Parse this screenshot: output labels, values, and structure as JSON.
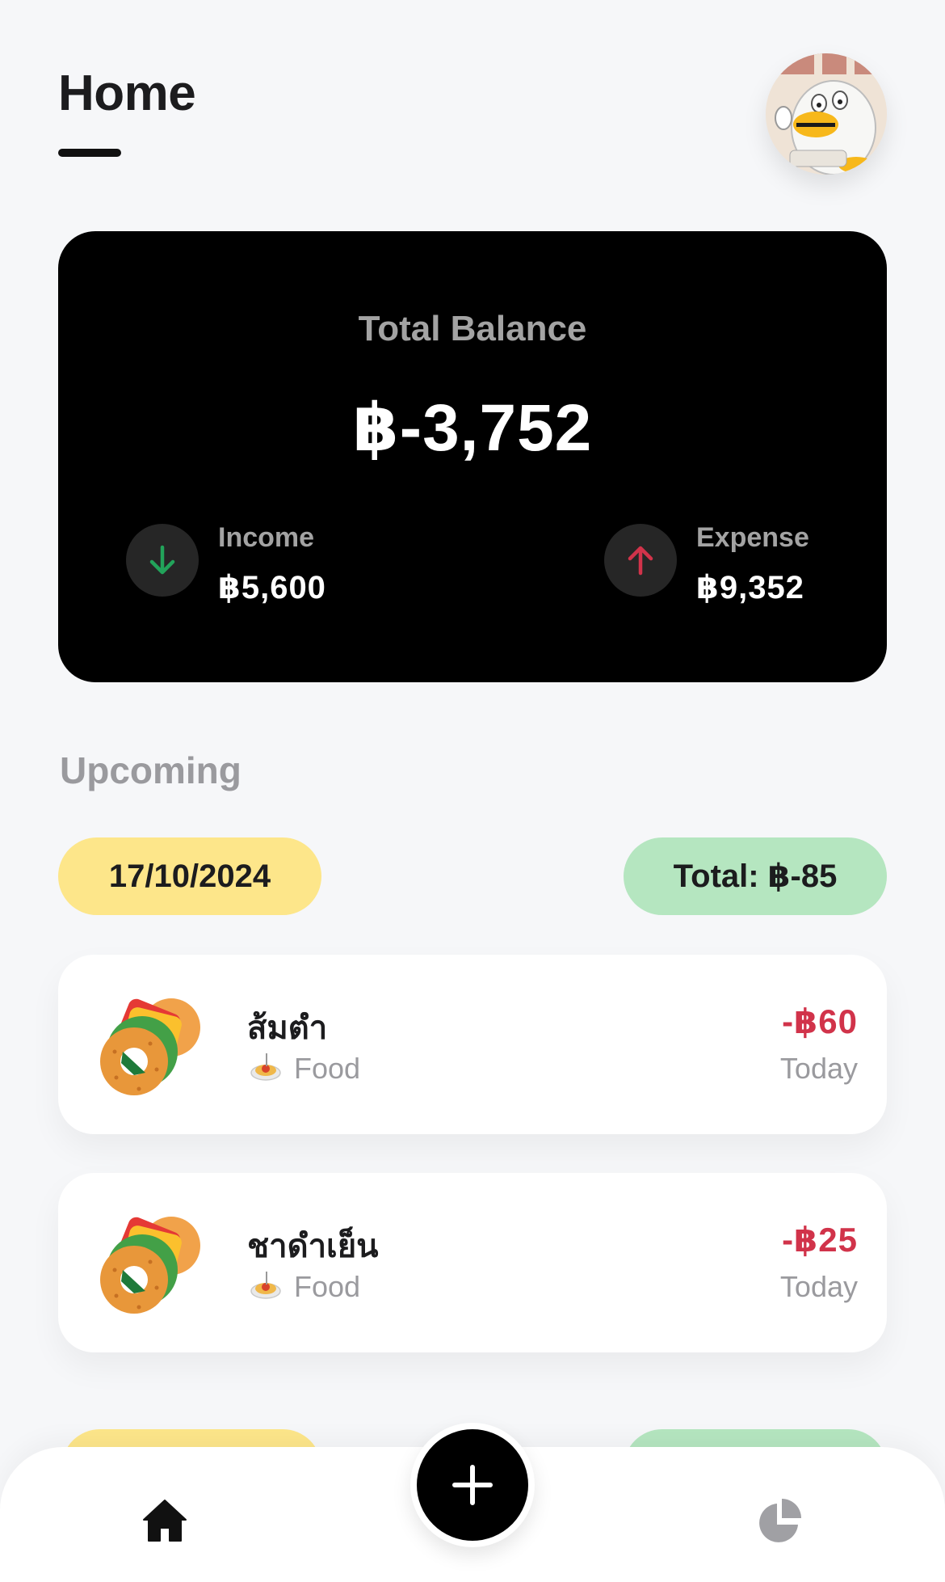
{
  "header": {
    "title": "Home"
  },
  "balance": {
    "label": "Total Balance",
    "value": "฿-3,752",
    "income": {
      "label": "Income",
      "value": "฿5,600",
      "icon": "arrow-down-icon",
      "color": "#22a35a"
    },
    "expense": {
      "label": "Expense",
      "value": "฿9,352",
      "icon": "arrow-up-icon",
      "color": "#d1334a"
    }
  },
  "upcoming": {
    "title": "Upcoming",
    "groups": [
      {
        "date": "17/10/2024",
        "total": "Total: ฿-85",
        "transactions": [
          {
            "name": "ส้มตำ",
            "category": "Food",
            "category_icon": "spaghetti-icon",
            "icon": "food-icon",
            "amount": "-฿60",
            "date": "Today"
          },
          {
            "name": "ชาดำเย็น",
            "category": "Food",
            "category_icon": "spaghetti-icon",
            "icon": "food-icon",
            "amount": "-฿25",
            "date": "Today"
          }
        ]
      }
    ]
  },
  "colors": {
    "expense_red": "#d1334a",
    "income_green": "#22a35a",
    "date_pill": "#fde68a",
    "total_pill": "#b5e6c0"
  },
  "tabbar": {
    "items": [
      "home-icon",
      "add-icon",
      "pie-chart-icon"
    ]
  }
}
